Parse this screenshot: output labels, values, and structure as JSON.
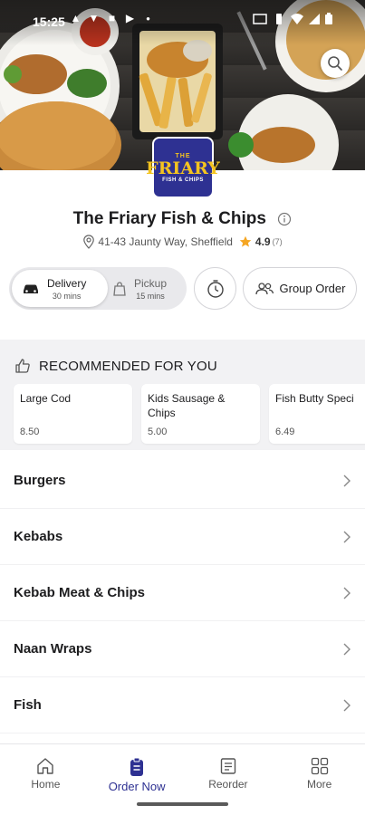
{
  "status_bar": {
    "time": "15:25"
  },
  "restaurant": {
    "logo_top": "THE",
    "logo_main": "FRIARY",
    "logo_sub": "FISH & CHIPS",
    "name": "The Friary Fish & Chips",
    "address": "41-43 Jaunty Way, Sheffield",
    "rating": "4.9",
    "rating_count": "(7)"
  },
  "order_mode": {
    "delivery": {
      "label": "Delivery",
      "time": "30 mins"
    },
    "pickup": {
      "label": "Pickup",
      "time": "15 mins"
    },
    "selected": "delivery",
    "group_order_label": "Group Order"
  },
  "recommended": {
    "heading": "RECOMMENDED FOR YOU",
    "items": [
      {
        "name": "Large Cod",
        "price": "8.50"
      },
      {
        "name": "Kids Sausage & Chips",
        "price": "5.00"
      },
      {
        "name": "Fish Butty Speci",
        "price": "6.49"
      }
    ]
  },
  "categories": [
    "Burgers",
    "Kebabs",
    "Kebab Meat & Chips",
    "Naan Wraps",
    "Fish"
  ],
  "bottom_nav": [
    {
      "label": "Home",
      "icon": "home-icon"
    },
    {
      "label": "Order Now",
      "icon": "order-icon"
    },
    {
      "label": "Reorder",
      "icon": "receipt-icon"
    },
    {
      "label": "More",
      "icon": "grid-icon"
    }
  ],
  "active_tab": "Order Now",
  "colors": {
    "brand": "#2e3192",
    "logo_text": "#f4c41f",
    "star": "#f5a623"
  }
}
